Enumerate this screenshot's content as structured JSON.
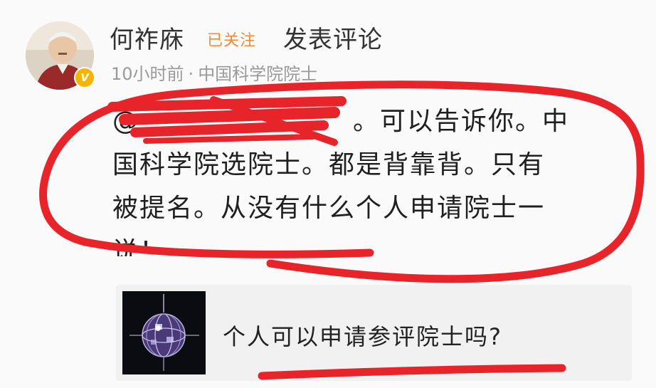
{
  "post": {
    "author_name": "何祚庥",
    "follow_status": "已关注",
    "action": "发表评论",
    "time_ago": "10小时前",
    "separator": "·",
    "verified_title": "中国科学院院士",
    "verified_badge": "V"
  },
  "comment": {
    "mention": "@",
    "lines": [
      "。可以告诉你。中",
      "国科学院选院士。都是背靠背。只有",
      "被提名。从没有什么个人申请院士一",
      "说！"
    ]
  },
  "linked_post": {
    "title": "个人可以申请参评院士吗?"
  },
  "colors": {
    "annotation_red": "#e8242b",
    "follow_orange": "#f08a3c",
    "meta_gray": "#9a9a9a",
    "badge_gold": "#f5b400"
  }
}
